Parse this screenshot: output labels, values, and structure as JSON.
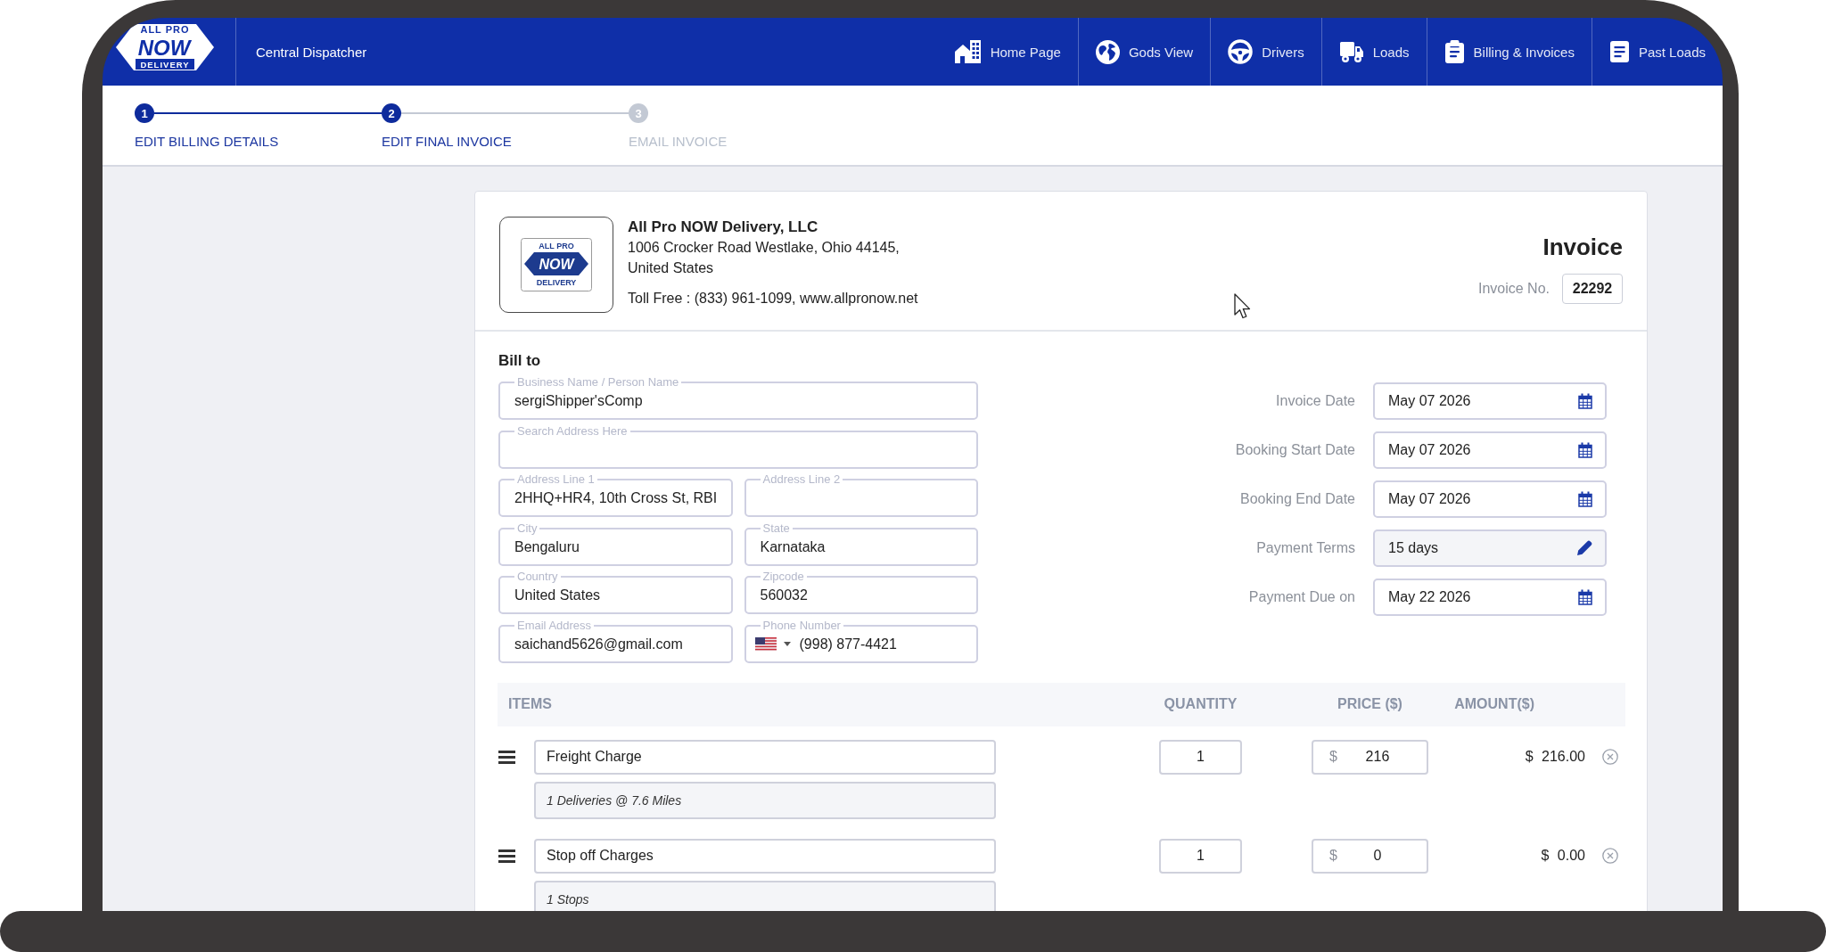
{
  "nav": {
    "logo": {
      "top": "ALL PRO",
      "middle": "NOW",
      "bottom": "DELIVERY"
    },
    "title": "Central Dispatcher",
    "items": [
      {
        "label": "Home Page"
      },
      {
        "label": "Gods View"
      },
      {
        "label": "Drivers"
      },
      {
        "label": "Loads"
      },
      {
        "label": "Billing & Invoices"
      },
      {
        "label": "Past Loads"
      }
    ]
  },
  "steps": [
    {
      "number": "1",
      "label": "EDIT BILLING DETAILS",
      "active": true
    },
    {
      "number": "2",
      "label": "EDIT FINAL INVOICE",
      "active": true
    },
    {
      "number": "3",
      "label": "EMAIL INVOICE",
      "active": false
    }
  ],
  "invoice": {
    "company": {
      "logo": {
        "top": "ALL PRO",
        "middle": "NOW",
        "bottom": "DELIVERY"
      },
      "name": "All Pro NOW Delivery, LLC",
      "address_lines": [
        "1006 Crocker Road Westlake, Ohio 44145,",
        "United States"
      ],
      "contact": "Toll Free : (833) 961-1099, www.allpronow.net"
    },
    "title": "Invoice",
    "invoice_no": {
      "label": "Invoice No.",
      "value": "22292"
    },
    "bill_to": {
      "heading": "Bill to",
      "rows": [
        [
          {
            "label": "Business Name / Person Name",
            "value": "sergiShipper'sComp",
            "kind": "text"
          }
        ],
        [
          {
            "label": "Search Address Here",
            "kind": "text"
          }
        ],
        [
          {
            "label": "Address Line 1",
            "value": "2HHQ+HR4, 10th Cross St, RBI",
            "kind": "text"
          },
          {
            "label": "Address Line 2",
            "kind": "text"
          }
        ],
        [
          {
            "label": "City",
            "value": "Bengaluru",
            "kind": "text"
          },
          {
            "label": "State",
            "value": "Karnataka",
            "kind": "text"
          }
        ],
        [
          {
            "label": "Country",
            "value": "United States",
            "kind": "text"
          },
          {
            "label": "Zipcode",
            "value": "560032",
            "kind": "text"
          }
        ],
        [
          {
            "label": "Email Address",
            "value": "saichand5626@gmail.com",
            "kind": "text"
          },
          {
            "label": "Phone Number",
            "value": "(998) 877-4421",
            "kind": "phone"
          }
        ]
      ]
    },
    "dates": [
      {
        "label": "Invoice Date",
        "value": "May 07 2026",
        "kind": "date"
      },
      {
        "label": "Booking Start Date",
        "value": "May 07 2026",
        "kind": "date"
      },
      {
        "label": "Booking End Date",
        "value": "May 07 2026",
        "kind": "date"
      },
      {
        "label": "Payment Terms",
        "value": "15 days",
        "kind": "terms"
      },
      {
        "label": "Payment Due on",
        "value": "May 22 2026",
        "kind": "date"
      }
    ],
    "items": {
      "columns": [
        "ITEMS",
        "QUANTITY",
        "PRICE ($)",
        "AMOUNT($)"
      ],
      "rows": [
        {
          "name": "Freight Charge",
          "description": "1 Deliveries @ 7.6 Miles",
          "quantity": "1",
          "currency": "$",
          "price": "216",
          "amount": "$ 216.00"
        },
        {
          "name": "Stop off Charges",
          "description": "1 Stops",
          "quantity": "1",
          "currency": "$",
          "price": "0",
          "amount": "$ 0.00"
        }
      ]
    }
  }
}
